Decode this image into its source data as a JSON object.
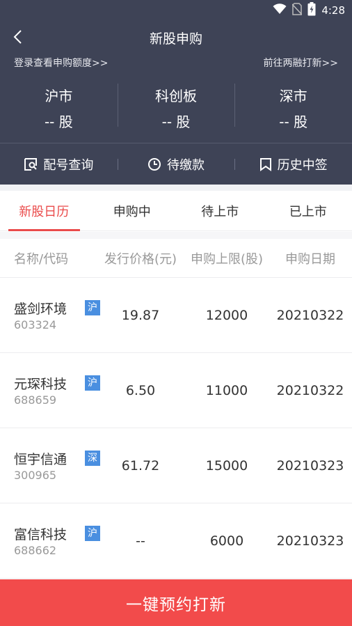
{
  "status_bar": {
    "time": "4:28"
  },
  "nav": {
    "title": "新股申购"
  },
  "links": {
    "left": "登录查看申购额度>>",
    "right": "前往两融打新>>"
  },
  "markets": [
    {
      "name": "沪市",
      "count": "-- 股"
    },
    {
      "name": "科创板",
      "count": "-- 股"
    },
    {
      "name": "深市",
      "count": "-- 股"
    }
  ],
  "actions": [
    {
      "label": "配号查询",
      "icon": "search-doc-icon"
    },
    {
      "label": "待缴款",
      "icon": "clock-icon"
    },
    {
      "label": "历史中签",
      "icon": "bookmark-icon"
    }
  ],
  "tabs": [
    {
      "label": "新股日历",
      "active": true
    },
    {
      "label": "申购中",
      "active": false
    },
    {
      "label": "待上市",
      "active": false
    },
    {
      "label": "已上市",
      "active": false
    }
  ],
  "table": {
    "headers": [
      "名称/代码",
      "发行价格(元)",
      "申购上限(股)",
      "申购日期"
    ],
    "rows": [
      {
        "name": "盛剑环境",
        "code": "603324",
        "market": "沪",
        "price": "19.87",
        "limit": "12000",
        "date": "20210322"
      },
      {
        "name": "元琛科技",
        "code": "688659",
        "market": "沪",
        "price": "6.50",
        "limit": "11000",
        "date": "20210322"
      },
      {
        "name": "恒宇信通",
        "code": "300965",
        "market": "深",
        "price": "61.72",
        "limit": "15000",
        "date": "20210323"
      },
      {
        "name": "富信科技",
        "code": "688662",
        "market": "沪",
        "price": "--",
        "limit": "6000",
        "date": "20210323"
      }
    ]
  },
  "bottom_button": {
    "label": "一键预约打新"
  },
  "colors": {
    "header_bg": "#3e4356",
    "accent_red": "#ea4b4b",
    "button_red": "#f24b4b",
    "tag_blue": "#4a8fe0"
  }
}
